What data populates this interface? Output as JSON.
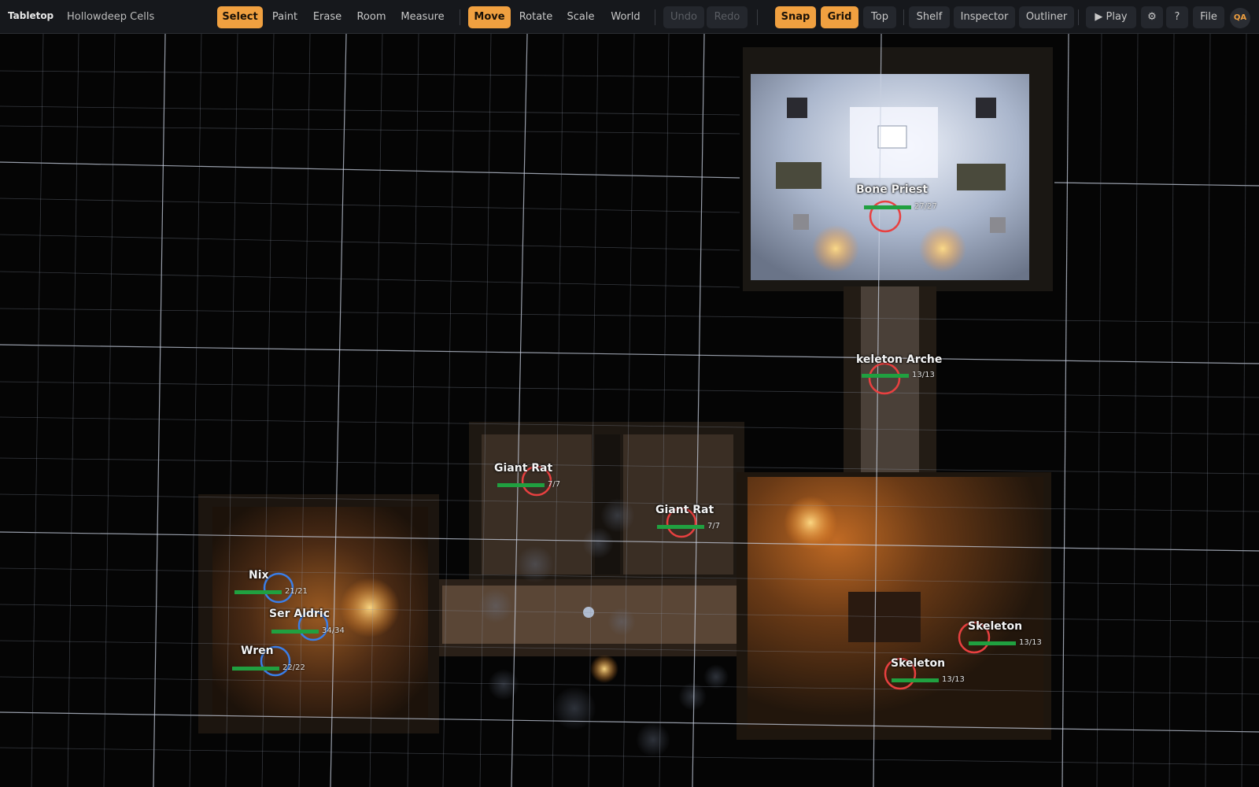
{
  "app": {
    "title": "Tabletop",
    "scene": "Hollowdeep Cells"
  },
  "toolbar": {
    "tools": [
      "Select",
      "Paint",
      "Erase",
      "Room",
      "Measure"
    ],
    "active_tool": "Select",
    "transform": [
      "Move",
      "Rotate",
      "Scale",
      "World"
    ],
    "active_transform": "Move",
    "history": [
      "Undo",
      "Redo"
    ],
    "snap": "Snap",
    "grid": "Grid",
    "top": "Top",
    "panels": [
      "Shelf",
      "Inspector",
      "Outliner"
    ],
    "play": "▶ Play",
    "settings_icon": "⚙",
    "help": "?",
    "file": "File",
    "qa": "QA"
  },
  "tokens": [
    {
      "name": "Bone Priest",
      "hp": "27/27",
      "hp_fraction": 1.0,
      "side": "enemy"
    },
    {
      "name": "keleton Arche",
      "hp": "13/13",
      "hp_fraction": 1.0,
      "side": "enemy"
    },
    {
      "name": "Giant Rat",
      "hp": "7/7",
      "hp_fraction": 1.0,
      "side": "enemy"
    },
    {
      "name": "Giant Rat",
      "hp": "7/7",
      "hp_fraction": 1.0,
      "side": "enemy"
    },
    {
      "name": "Nix",
      "hp": "21/21",
      "hp_fraction": 1.0,
      "side": "party"
    },
    {
      "name": "Ser Aldric",
      "hp": "34/34",
      "hp_fraction": 1.0,
      "side": "party"
    },
    {
      "name": "Wren",
      "hp": "22/22",
      "hp_fraction": 1.0,
      "side": "party"
    },
    {
      "name": "Skeleton",
      "hp": "13/13",
      "hp_fraction": 1.0,
      "side": "enemy"
    },
    {
      "name": "Skeleton",
      "hp": "13/13",
      "hp_fraction": 1.0,
      "side": "enemy"
    }
  ],
  "colors": {
    "accent": "#f0a040",
    "party_ring": "#3a7ee8",
    "enemy_ring": "#e84040",
    "hp_fill": "#20a040"
  }
}
